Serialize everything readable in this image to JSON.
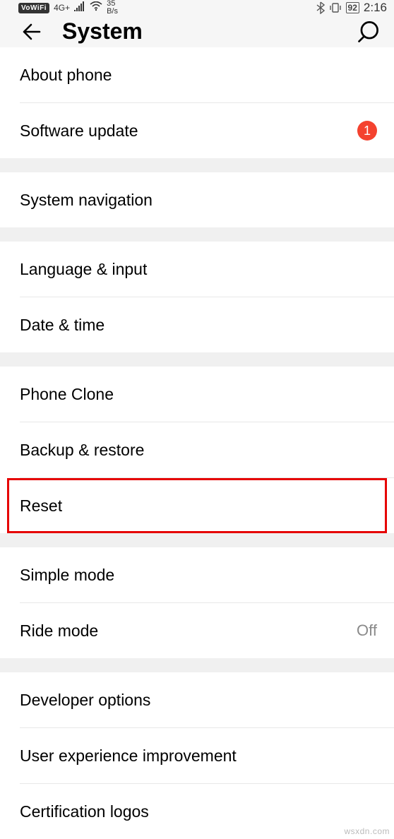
{
  "status": {
    "vowifi": "VoWiFi",
    "net_top": "4G+",
    "net_sub": "↑↓",
    "speed_top": "35",
    "speed_unit": "B/s",
    "battery": "92",
    "time": "2:16"
  },
  "header": {
    "title": "System"
  },
  "sections": [
    {
      "rows": [
        {
          "id": "about-phone",
          "label": "About phone"
        },
        {
          "id": "software-update",
          "label": "Software update",
          "badge": "1"
        }
      ]
    },
    {
      "rows": [
        {
          "id": "system-navigation",
          "label": "System navigation"
        }
      ]
    },
    {
      "rows": [
        {
          "id": "language-input",
          "label": "Language & input"
        },
        {
          "id": "date-time",
          "label": "Date & time"
        }
      ]
    },
    {
      "rows": [
        {
          "id": "phone-clone",
          "label": "Phone Clone"
        },
        {
          "id": "backup-restore",
          "label": "Backup & restore"
        },
        {
          "id": "reset",
          "label": "Reset",
          "highlight": true
        }
      ]
    },
    {
      "rows": [
        {
          "id": "simple-mode",
          "label": "Simple mode"
        },
        {
          "id": "ride-mode",
          "label": "Ride mode",
          "value": "Off"
        }
      ]
    },
    {
      "rows": [
        {
          "id": "developer-options",
          "label": "Developer options"
        },
        {
          "id": "user-experience-improvement",
          "label": "User experience improvement"
        },
        {
          "id": "certification-logos",
          "label": "Certification logos"
        }
      ]
    }
  ],
  "watermark": "wsxdn.com"
}
